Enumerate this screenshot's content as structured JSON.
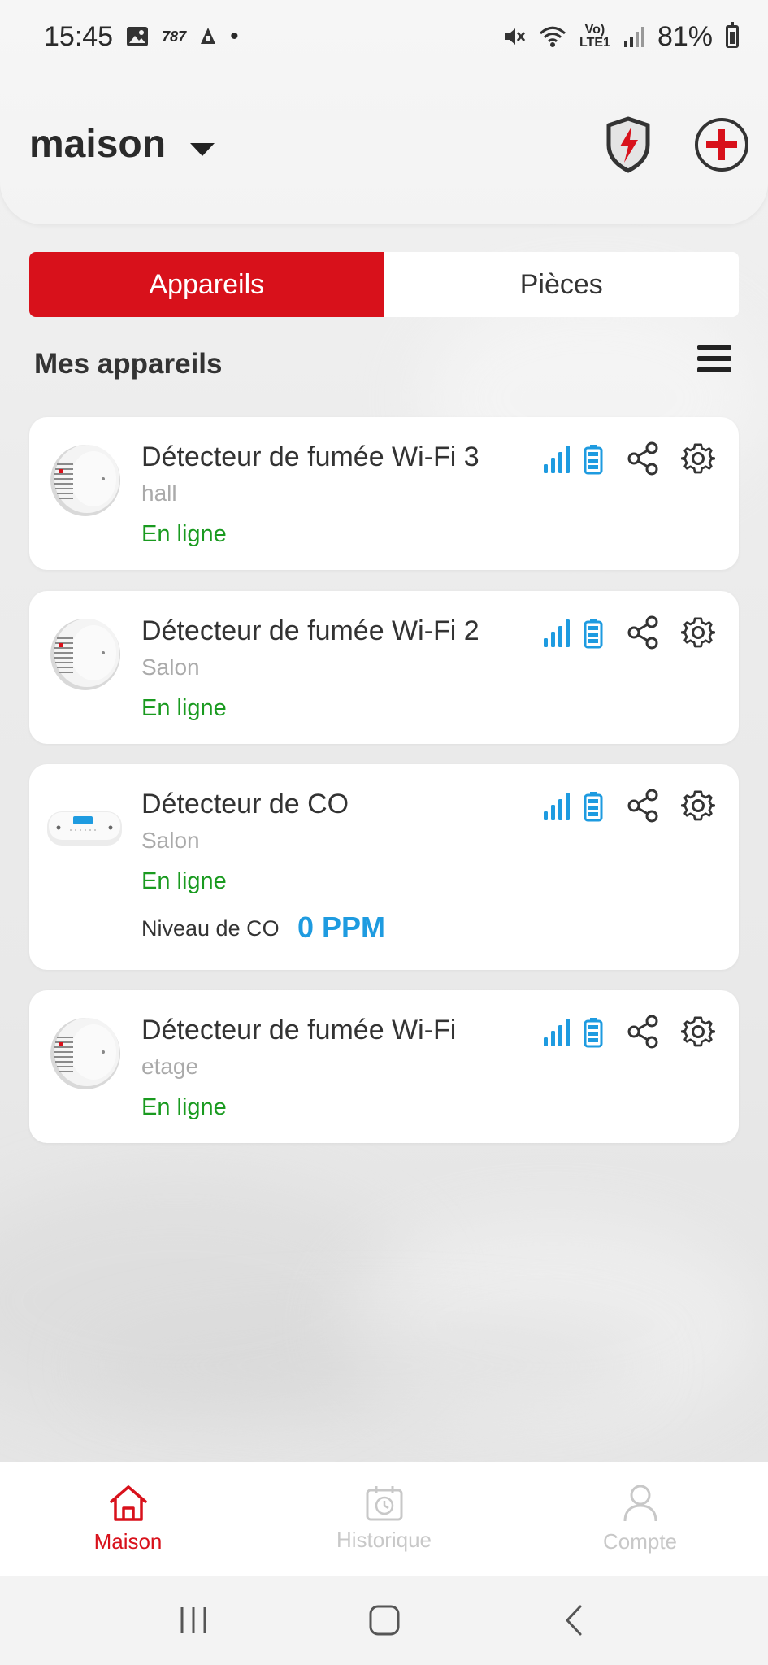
{
  "status_bar": {
    "time": "15:45",
    "carrier_badge": "787",
    "volte": "Vo)",
    "lte": "LTE1",
    "battery": "81%"
  },
  "header": {
    "home_name": "maison"
  },
  "tabs": [
    {
      "label": "Appareils",
      "active": true
    },
    {
      "label": "Pièces",
      "active": false
    }
  ],
  "section": {
    "title": "Mes appareils"
  },
  "devices": [
    {
      "name": "Détecteur de fumée Wi-Fi 3",
      "room": "hall",
      "status": "En ligne",
      "type": "smoke"
    },
    {
      "name": "Détecteur de fumée Wi-Fi 2",
      "room": "Salon",
      "status": "En ligne",
      "type": "smoke"
    },
    {
      "name": "Détecteur de CO",
      "room": "Salon",
      "status": "En ligne",
      "type": "co",
      "co_label": "Niveau de CO",
      "co_value": "0 PPM"
    },
    {
      "name": "Détecteur de fumée Wi-Fi",
      "room": "etage",
      "status": "En ligne",
      "type": "smoke"
    }
  ],
  "bottom_nav": [
    {
      "label": "Maison",
      "icon": "home-icon",
      "active": true
    },
    {
      "label": "Historique",
      "icon": "history-icon",
      "active": false
    },
    {
      "label": "Compte",
      "icon": "user-icon",
      "active": false
    }
  ],
  "colors": {
    "accent_red": "#d8111b",
    "online_green": "#199a1f",
    "signal_blue": "#1e9be0"
  }
}
